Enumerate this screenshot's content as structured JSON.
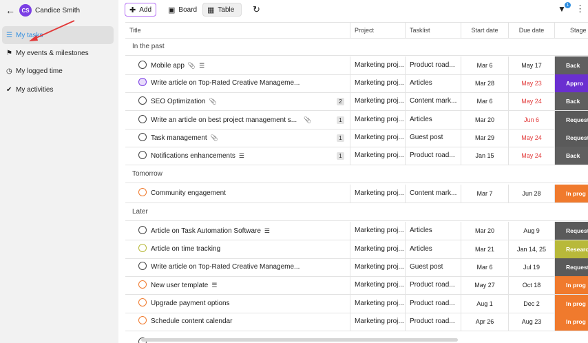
{
  "sidebar": {
    "user_name": "Candice Smith",
    "avatar_initials": "CS",
    "items": [
      {
        "label": "My tasks",
        "icon": "list-icon",
        "active": true
      },
      {
        "label": "My events & milestones",
        "icon": "flag-icon",
        "active": false
      },
      {
        "label": "My logged time",
        "icon": "clock-icon",
        "active": false
      },
      {
        "label": "My activities",
        "icon": "check-icon",
        "active": false
      }
    ]
  },
  "toolbar": {
    "add_label": "Add",
    "board_label": "Board",
    "table_label": "Table",
    "filter_count": "1"
  },
  "columns": [
    "Title",
    "Project",
    "Tasklist",
    "Start date",
    "Due date",
    "Stage"
  ],
  "sections": [
    {
      "label": "In the past"
    },
    {
      "label": "Tomorrow"
    },
    {
      "label": "Later"
    }
  ],
  "rows": [
    {
      "title": "Mobile app",
      "project": "Marketing proj...",
      "tasklist": "Product road...",
      "start": "Mar 6",
      "due": "May 17",
      "stage": "Back"
    },
    {
      "title": "Write article on Top-Rated Creative Manageme...",
      "project": "Marketing proj...",
      "tasklist": "Articles",
      "start": "Mar 28",
      "due": "May 23",
      "stage": "Appro"
    },
    {
      "title": "SEO Optimization",
      "project": "Marketing proj...",
      "tasklist": "Content mark...",
      "start": "Mar 6",
      "due": "May 24",
      "stage": "Back",
      "count": "2"
    },
    {
      "title": "Write an article on best project management s...",
      "project": "Marketing proj...",
      "tasklist": "Articles",
      "start": "Mar 20",
      "due": "Jun 6",
      "stage": "Request",
      "count": "1"
    },
    {
      "title": "Task management",
      "project": "Marketing proj...",
      "tasklist": "Guest post",
      "start": "Mar 29",
      "due": "May 24",
      "stage": "Request",
      "count": "1"
    },
    {
      "title": "Notifications enhancements",
      "project": "Marketing proj...",
      "tasklist": "Product road...",
      "start": "Jan 15",
      "due": "May 24",
      "stage": "Back",
      "count": "1"
    },
    {
      "title": "Community engagement",
      "project": "Marketing proj...",
      "tasklist": "Content mark...",
      "start": "Mar 7",
      "due": "Jun 28",
      "stage": "In prog"
    },
    {
      "title": "Article on Task Automation Software",
      "project": "Marketing proj...",
      "tasklist": "Articles",
      "start": "Mar 20",
      "due": "Aug 9",
      "stage": "Request"
    },
    {
      "title": "Article on time tracking",
      "project": "Marketing proj...",
      "tasklist": "Articles",
      "start": "Mar 21",
      "due": "Jan 14, 25",
      "stage": "Research"
    },
    {
      "title": "Write article on Top-Rated Creative Manageme...",
      "project": "Marketing proj...",
      "tasklist": "Guest post",
      "start": "Mar 6",
      "due": "Jul 19",
      "stage": "Request"
    },
    {
      "title": "New user template",
      "project": "Marketing proj...",
      "tasklist": "Product road...",
      "start": "May 27",
      "due": "Oct 18",
      "stage": "In prog"
    },
    {
      "title": "Upgrade payment options",
      "project": "Marketing proj...",
      "tasklist": "Product road...",
      "start": "Aug 1",
      "due": "Dec 2",
      "stage": "In prog"
    },
    {
      "title": "Schedule content calendar",
      "project": "Marketing proj...",
      "tasklist": "Product road...",
      "start": "Apr 26",
      "due": "Aug 23",
      "stage": "In prog"
    }
  ],
  "colors": {
    "stage_back": "#5f5f5f",
    "stage_approved": "#6a2fd0",
    "stage_request": "#5a5a5a",
    "stage_in_progress": "#f07a2d",
    "stage_research": "#b8b93a",
    "overdue": "#e23a3a",
    "accent": "#2f8ee0"
  }
}
